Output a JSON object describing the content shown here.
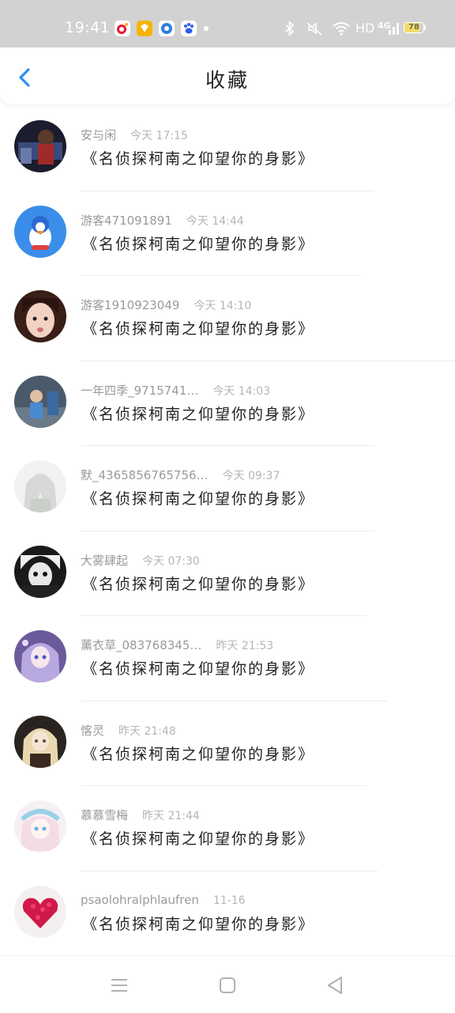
{
  "status_bar": {
    "time": "19:41",
    "network": "HD",
    "signal_type": "4G",
    "battery": "78",
    "battery_level": 0.78,
    "app_icons": [
      {
        "icon": "weibo-icon",
        "color": "#f5c21a"
      },
      {
        "icon": "diamond-app-icon",
        "color": "#f5b400"
      },
      {
        "icon": "browser-app-icon",
        "color": "#2f7fe0"
      },
      {
        "icon": "baidu-app-icon",
        "color": "#2f5fe8"
      }
    ]
  },
  "header": {
    "title": "收藏",
    "back_icon": "chevron-left-icon",
    "accent_color": "#2d8ff0"
  },
  "favorites": [
    {
      "user": "安与闲",
      "time": "今天 17:15",
      "content": "《名侦探柯南之仰望你的身影》"
    },
    {
      "user": "游客471091891",
      "time": "今天 14:44",
      "content": "《名侦探柯南之仰望你的身影》"
    },
    {
      "user": "游客1910923049",
      "time": "今天 14:10",
      "content": "《名侦探柯南之仰望你的身影》"
    },
    {
      "user": "一年四季_9715741…",
      "time": "今天 14:03",
      "content": "《名侦探柯南之仰望你的身影》"
    },
    {
      "user": "默_4365856765756…",
      "time": "今天 09:37",
      "content": "《名侦探柯南之仰望你的身影》"
    },
    {
      "user": "大雾肆起",
      "time": "今天 07:30",
      "content": "《名侦探柯南之仰望你的身影》"
    },
    {
      "user": "薰衣草_083768345…",
      "time": "昨天 21:53",
      "content": "《名侦探柯南之仰望你的身影》"
    },
    {
      "user": "愘灵",
      "time": "昨天 21:48",
      "content": "《名侦探柯南之仰望你的身影》"
    },
    {
      "user": "慕慕雪梅",
      "time": "昨天 21:44",
      "content": "《名侦探柯南之仰望你的身影》"
    },
    {
      "user": "psaolohralphlaufren",
      "time": "11-16",
      "content": "《名侦探柯南之仰望你的身影》"
    }
  ],
  "nav_bar": {
    "menu_icon": "menu-icon",
    "home_icon": "home-square-icon",
    "back_icon": "back-triangle-icon"
  }
}
